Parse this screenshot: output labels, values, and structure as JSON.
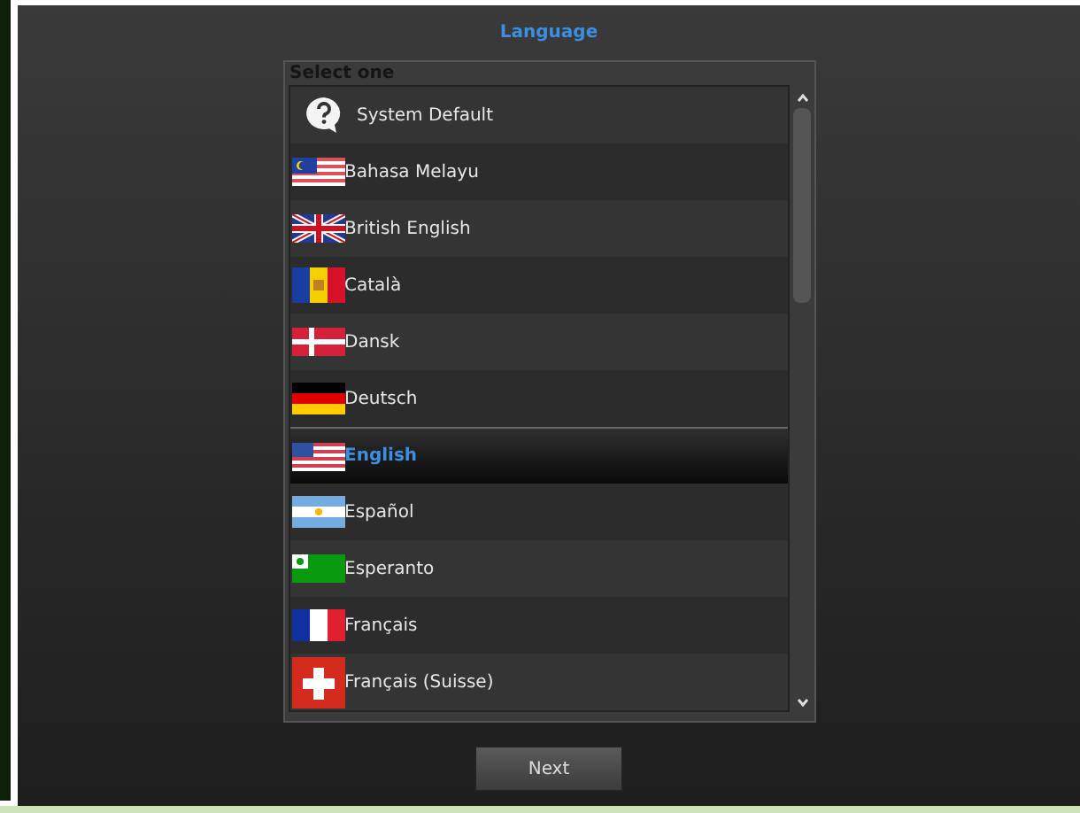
{
  "title": "Language",
  "list": {
    "header": "Select one",
    "items": [
      {
        "label": "System Default",
        "kind": "help",
        "selected": false
      },
      {
        "label": "Bahasa Melayu",
        "kind": "my",
        "selected": false
      },
      {
        "label": "British English",
        "kind": "gb",
        "selected": false
      },
      {
        "label": "Català",
        "kind": "ad",
        "selected": false
      },
      {
        "label": "Dansk",
        "kind": "dk",
        "selected": false
      },
      {
        "label": "Deutsch",
        "kind": "de",
        "selected": false
      },
      {
        "label": "English",
        "kind": "us",
        "selected": true
      },
      {
        "label": "Español",
        "kind": "ar",
        "selected": false
      },
      {
        "label": "Esperanto",
        "kind": "eo",
        "selected": false
      },
      {
        "label": "Français",
        "kind": "fr",
        "selected": false
      },
      {
        "label": "Français (Suisse)",
        "kind": "ch",
        "selected": false
      }
    ]
  },
  "button": "Next"
}
